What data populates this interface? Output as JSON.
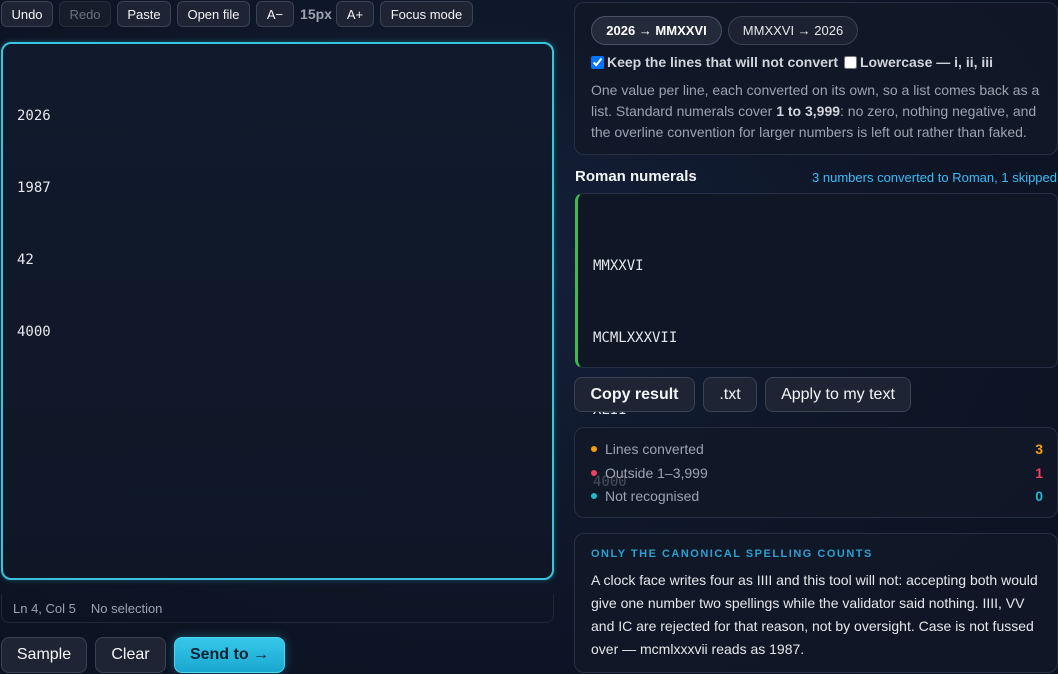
{
  "toolbar": {
    "undo": "Undo",
    "redo": "Redo",
    "paste": "Paste",
    "open_file": "Open file",
    "font_smaller": "A−",
    "font_size": "15px",
    "font_larger": "A+",
    "focus_mode": "Focus mode"
  },
  "editor": {
    "lines": [
      "2026",
      "1987",
      "42",
      "4000"
    ],
    "status_position": "Ln 4, Col 5",
    "status_selection": "No selection"
  },
  "bottom_actions": {
    "sample": "Sample",
    "clear": "Clear",
    "send_to": "Send to →"
  },
  "mode": {
    "to_roman": "2026 → MMXXVI",
    "to_arabic": "MMXXVI → 2026",
    "selected": "to_roman"
  },
  "options": {
    "keep_lines_label": "Keep the lines that will not convert",
    "keep_lines_checked": true,
    "lowercase_label": "Lowercase — i, ii, iii",
    "lowercase_checked": false
  },
  "description": {
    "part1": "One value per line, each converted on its own, so a list comes back as a list. Standard numerals cover ",
    "range": "1 to 3,999",
    "part2": ": no zero, nothing negative, and the overline convention for larger numbers is left out rather than faked."
  },
  "output": {
    "title": "Roman numerals",
    "summary": "3 numbers converted to Roman, 1 skipped",
    "lines": [
      "MMXXVI",
      "MCMLXXXVII",
      "XLII",
      "4000"
    ]
  },
  "output_actions": {
    "copy": "Copy result",
    "txt": ".txt",
    "apply": "Apply to my text"
  },
  "stats": [
    {
      "label": "Lines converted",
      "value": "3",
      "color": "#f59e0b"
    },
    {
      "label": "Outside 1–3,999",
      "value": "1",
      "color": "#f43f5e"
    },
    {
      "label": "Not recognised",
      "value": "0",
      "color": "#22b8cf"
    }
  ],
  "note": {
    "heading": "ONLY THE CANONICAL SPELLING COUNTS",
    "body": "A clock face writes four as IIII and this tool will not: accepting both would give one number two spellings while the validator said nothing. IIII, VV and IC are rejected for that reason, not by oversight. Case is not fussed over — mcmlxxxvii reads as 1987."
  },
  "colors": {
    "accent": "#38c4dd",
    "output_bar": "#3fb950"
  }
}
